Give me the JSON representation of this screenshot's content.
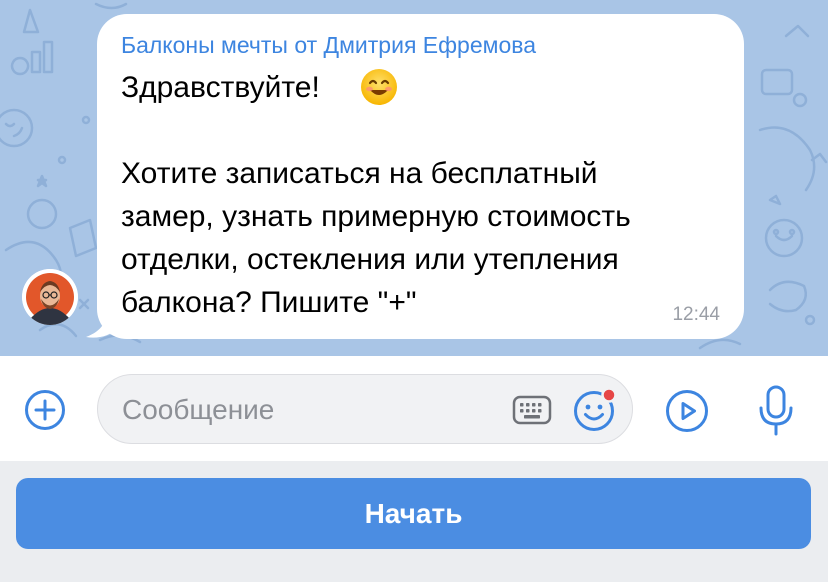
{
  "colors": {
    "chat_background": "#a9c5e6",
    "accent": "#3d85e0",
    "button": "#4b8de2",
    "time_text": "#9a9ea6",
    "placeholder_text": "#8d9096",
    "badge": "#e64646"
  },
  "message": {
    "sender": "Балконы мечты от Дмитрия Ефремова",
    "greeting": "Здравствуйте!",
    "greeting_emoji": "smiling-face-emoji",
    "body_lines": [
      "Хотите записаться на бесплатный",
      "замер, узнать примерную стоимость",
      "отделки, остекления или утепления",
      "балкона? Пишите \"+\""
    ],
    "time": "12:44"
  },
  "composer": {
    "placeholder": "Сообщение",
    "icons": [
      "plus-circle-icon",
      "keyboard-icon",
      "emoji-smile-icon",
      "play-circle-icon",
      "microphone-icon"
    ]
  },
  "action": {
    "start_label": "Начать"
  }
}
